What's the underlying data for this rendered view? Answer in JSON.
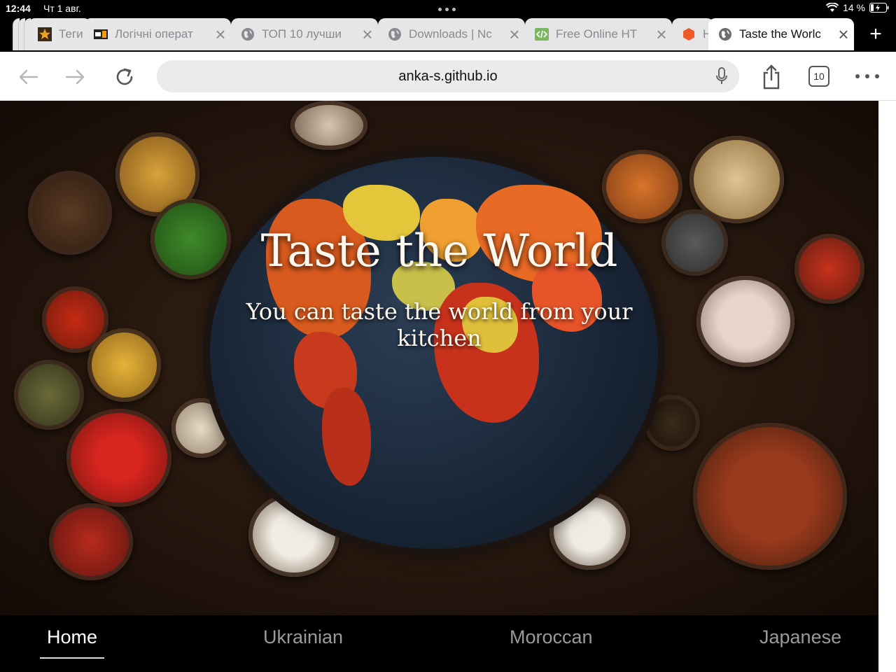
{
  "status_bar": {
    "time": "12:44",
    "date": "Чт 1 авг.",
    "battery": "14 %"
  },
  "tabs": [
    {
      "title": "Теги",
      "favicon": "star-icon",
      "active": false
    },
    {
      "title": "Логічні операт",
      "favicon": "site-badge-icon",
      "active": false
    },
    {
      "title": "ТОП 10 лучши",
      "favicon": "globe-icon",
      "active": false
    },
    {
      "title": "Downloads | Nc",
      "favicon": "globe-icon",
      "active": false
    },
    {
      "title": "Free Online HT",
      "favicon": "code-icon",
      "active": false
    },
    {
      "title": "H",
      "favicon": "hexagon-icon",
      "active": false
    },
    {
      "title": "Taste the Worlc",
      "favicon": "globe-icon",
      "active": true
    }
  ],
  "toolbar": {
    "url": "anka-s.github.io",
    "tab_count": "10"
  },
  "hero": {
    "title": "Taste the World",
    "subtitle": "You can taste the world from your kitchen"
  },
  "nav": {
    "items": [
      "Home",
      "Ukrainian",
      "Moroccan",
      "Japanese"
    ],
    "active": "Home"
  },
  "colors": {
    "page_bg": "#000000",
    "hero_text": "#fff8ee",
    "nav_inactive": "#9a9a9a",
    "nav_active": "#ffffff"
  }
}
